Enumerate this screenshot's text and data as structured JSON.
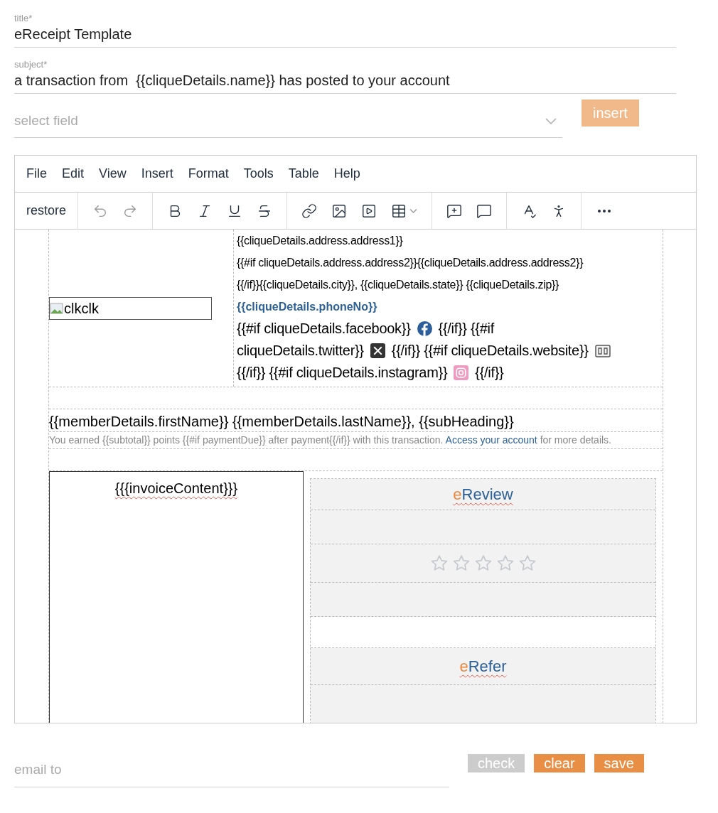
{
  "title_field": {
    "label": "title*",
    "value": "eReceipt Template"
  },
  "subject_field": {
    "label": "subject*",
    "value": "a transaction from  {{cliqueDetails.name}} has posted to your account"
  },
  "select_field": {
    "placeholder": "select field"
  },
  "insert_button": {
    "label": "insert",
    "disabled": true
  },
  "editor": {
    "menu": [
      "File",
      "Edit",
      "View",
      "Insert",
      "Format",
      "Tools",
      "Table",
      "Help"
    ],
    "restore_button": "restore",
    "logo_alt": "clkclk",
    "address_lines": [
      "{{cliqueDetails.address.address1}}",
      "{{#if cliqueDetails.address.address2}}{{cliqueDetails.address.address2}}",
      "{{/if}}{{cliqueDetails.city}}, {{cliqueDetails.state}} {{cliqueDetails.zip}}"
    ],
    "phone": "{{cliqueDetails.phoneNo}}",
    "social_lines": [
      [
        {
          "kind": "text",
          "text": "{{#if cliqueDetails.facebook}}"
        },
        {
          "kind": "icon"
        },
        {
          "kind": "text",
          "text": "{{/if}} {{#if"
        }
      ],
      [
        {
          "kind": "text",
          "text": "cliqueDetails.twitter}}"
        },
        {
          "kind": "icon"
        },
        {
          "kind": "text",
          "text": "{{/if}} {{#if cliqueDetails.website}}"
        },
        {
          "kind": "icon"
        }
      ],
      [
        {
          "kind": "text",
          "text": "{{/if}} {{#if cliqueDetails.instagram}}"
        },
        {
          "kind": "icon"
        },
        {
          "kind": "text",
          "text": "{{/if}}"
        }
      ]
    ],
    "member_line": "{{memberDetails.firstName}} {{memberDetails.lastName}}, {{subHeading}}",
    "points_text": "You earned {{subtotal}} points {{#if paymentDue}} after payment{{/if}} with this transaction.",
    "account_link": "Access your account",
    "points_tail": "for more details.",
    "invoice": "{{{invoiceContent}}}",
    "review": {
      "accent": "e",
      "rest": "Review",
      "stars": 0
    },
    "refer": {
      "accent": "e",
      "rest": "Refer"
    }
  },
  "email_field": {
    "placeholder": "email to"
  },
  "buttons": [
    {
      "label": "check",
      "disabled": true
    },
    {
      "label": "clear",
      "disabled": false
    },
    {
      "label": "save",
      "disabled": false
    }
  ]
}
